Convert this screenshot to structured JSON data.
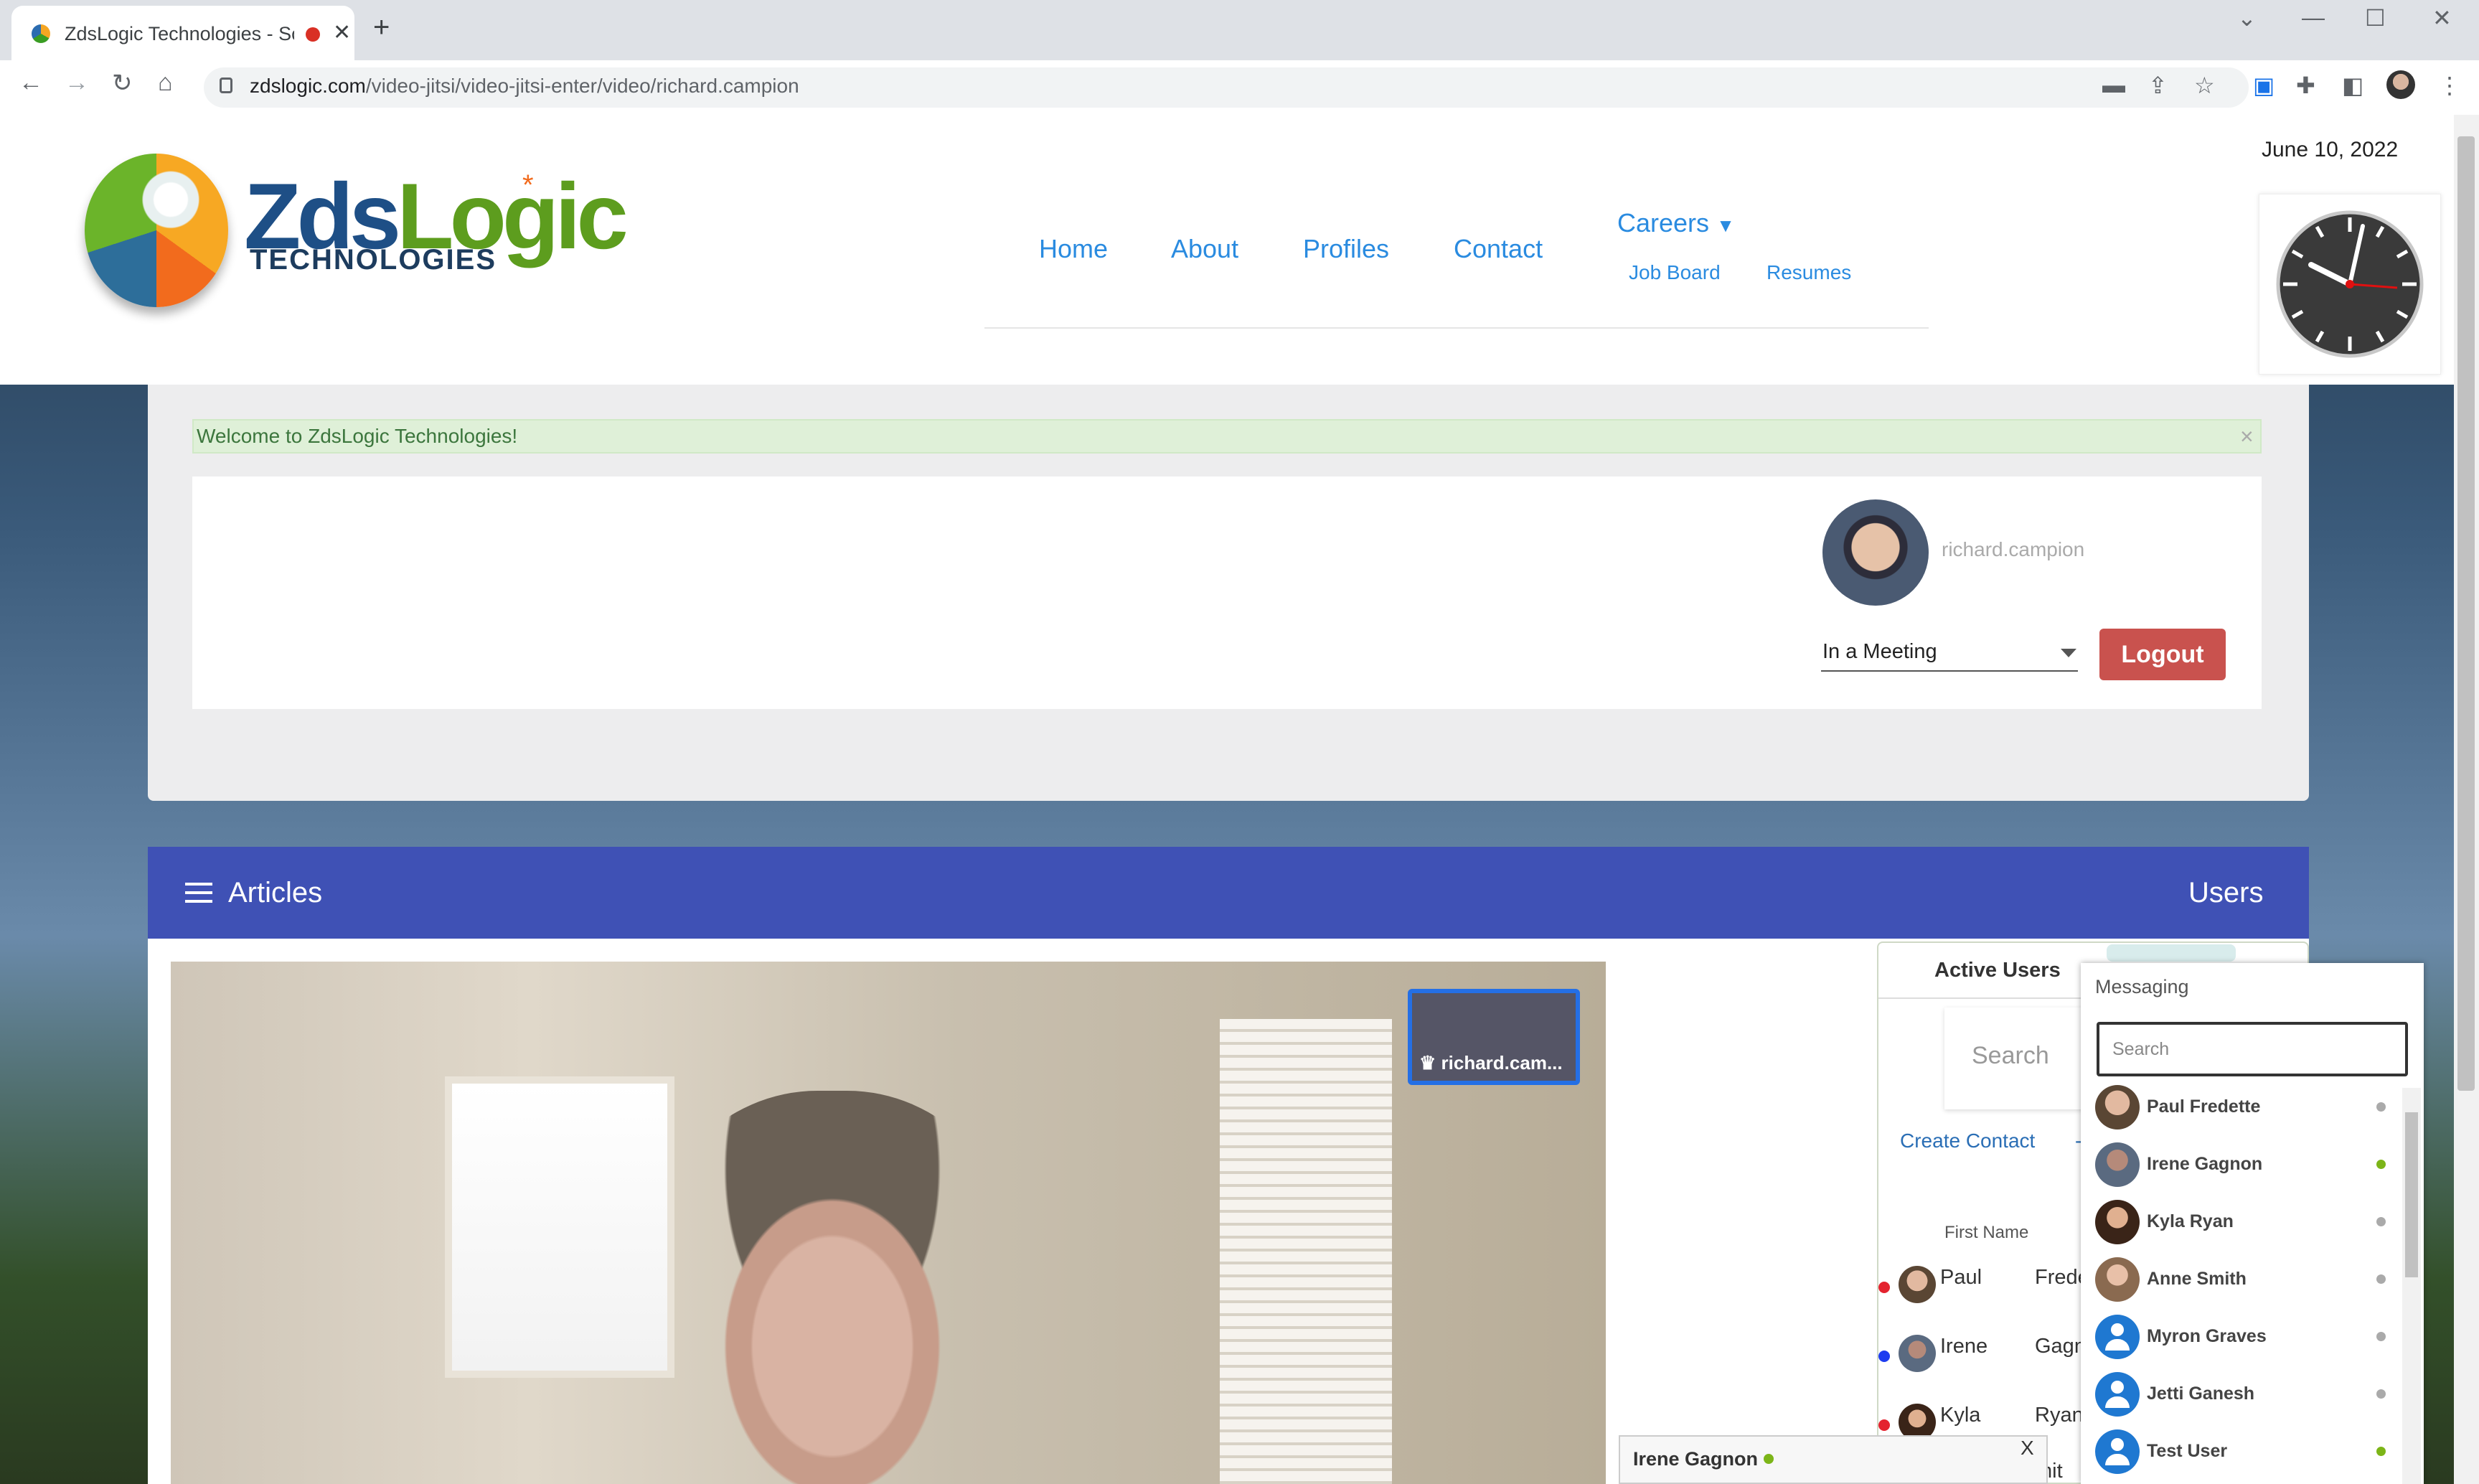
{
  "browser": {
    "tab_title": "ZdsLogic Technologies - Soft",
    "tab_close": "✕",
    "new_tab": "+",
    "url_host": "zdslogic.com",
    "url_path": "/video-jitsi/video-jitsi-enter/video/richard.campion",
    "win_minimize": "—",
    "win_maximize": "☐",
    "win_close": "✕",
    "win_tablist": "⌄",
    "back": "←",
    "forward": "→",
    "reload": "↻",
    "home": "⌂",
    "icons": [
      "camera-icon",
      "share-icon",
      "star-icon",
      "extension-icon",
      "puzzle-icon",
      "sidepanel-icon",
      "profile-icon",
      "menu-icon"
    ]
  },
  "header": {
    "logo_text_a": "Zds",
    "logo_text_b": "Logic",
    "logo_sub": "TECHNOLOGIES",
    "logo_star": "*",
    "nav": {
      "home": "Home",
      "about": "About",
      "profiles": "Profiles",
      "contact": "Contact",
      "careers": "Careers",
      "job_board": "Job Board",
      "resumes": "Resumes"
    },
    "date": "June 10, 2022"
  },
  "welcome": {
    "message": "Welcome to ZdsLogic Technologies!",
    "close": "×"
  },
  "user": {
    "username": "richard.campion",
    "status": "In a Meeting",
    "logout": "Logout"
  },
  "bar": {
    "articles": "Articles",
    "users": "Users"
  },
  "video": {
    "thumb_label": "♛ richard.cam..."
  },
  "active_users": {
    "tab": "Active Users",
    "search": "Search",
    "create_contact": "Create Contact",
    "dash": "-",
    "first_name_header": "First Name",
    "rows": [
      {
        "first": "Paul",
        "last": "Frede",
        "dot": "#e4232f"
      },
      {
        "first": "Irene",
        "last": "Gagn",
        "dot": "#1d3cf0"
      },
      {
        "first": "Kyla",
        "last": "Ryan",
        "dot": "#e4232f"
      },
      {
        "first": "",
        "last": "mit",
        "dot": ""
      }
    ]
  },
  "messaging": {
    "title": "Messaging",
    "search_placeholder": "Search",
    "contacts": [
      {
        "name": "Paul Fredette",
        "status_color": "#aaaaaa"
      },
      {
        "name": "Irene Gagnon",
        "status_color": "#7cb518"
      },
      {
        "name": "Kyla Ryan",
        "status_color": "#aaaaaa"
      },
      {
        "name": "Anne Smith",
        "status_color": "#aaaaaa"
      },
      {
        "name": "Myron Graves",
        "status_color": "#aaaaaa"
      },
      {
        "name": "Jetti Ganesh",
        "status_color": "#aaaaaa"
      },
      {
        "name": "Test User",
        "status_color": "#7cb518"
      }
    ]
  },
  "chat": {
    "name": "Irene Gagnon",
    "close": "X"
  }
}
